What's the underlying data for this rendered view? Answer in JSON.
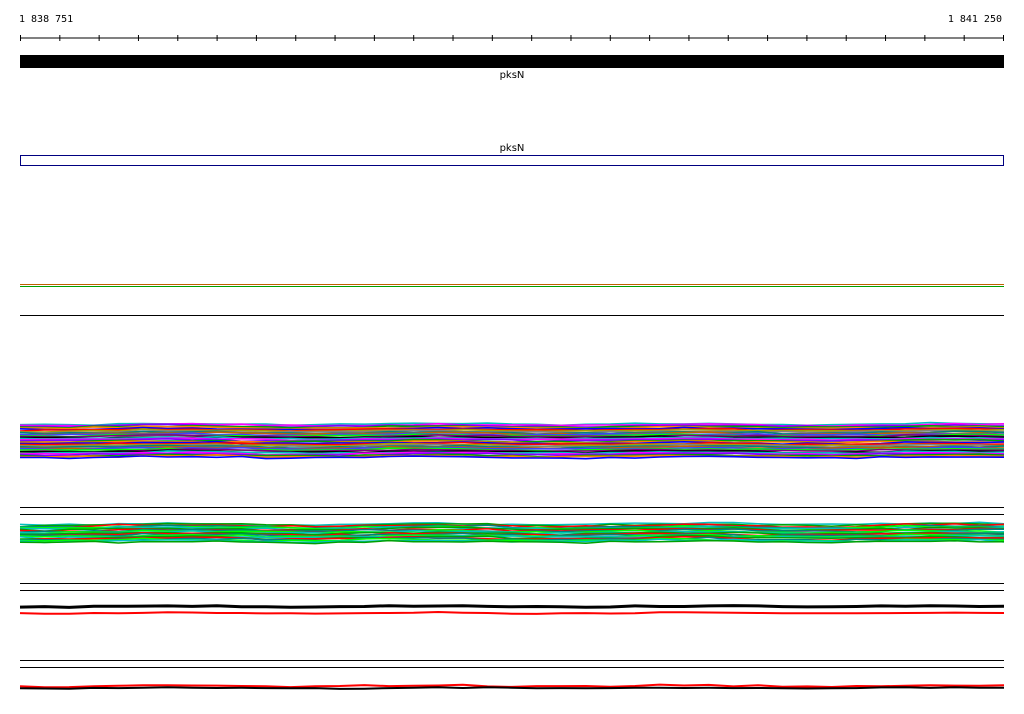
{
  "ruler": {
    "start_label": "1 838 751",
    "end_label": "1 841 250",
    "tick_count": 26
  },
  "gene_track": {
    "label": "pksN",
    "color": "#000000"
  },
  "transcript_track": {
    "label": "pksN",
    "color": "#000080"
  },
  "colors": {
    "palette": [
      "#00c0c0",
      "#ff00ff",
      "#8000ff",
      "#00a000",
      "#ff8000",
      "#0000ff",
      "#ff0000",
      "#a0a000",
      "#808080",
      "#008080",
      "#c06000",
      "#4040ff",
      "#00ff00",
      "#800080",
      "#000000"
    ],
    "coverage_primary": "#000000",
    "coverage_secondary": "#ff0000",
    "separator": "#000000"
  }
}
